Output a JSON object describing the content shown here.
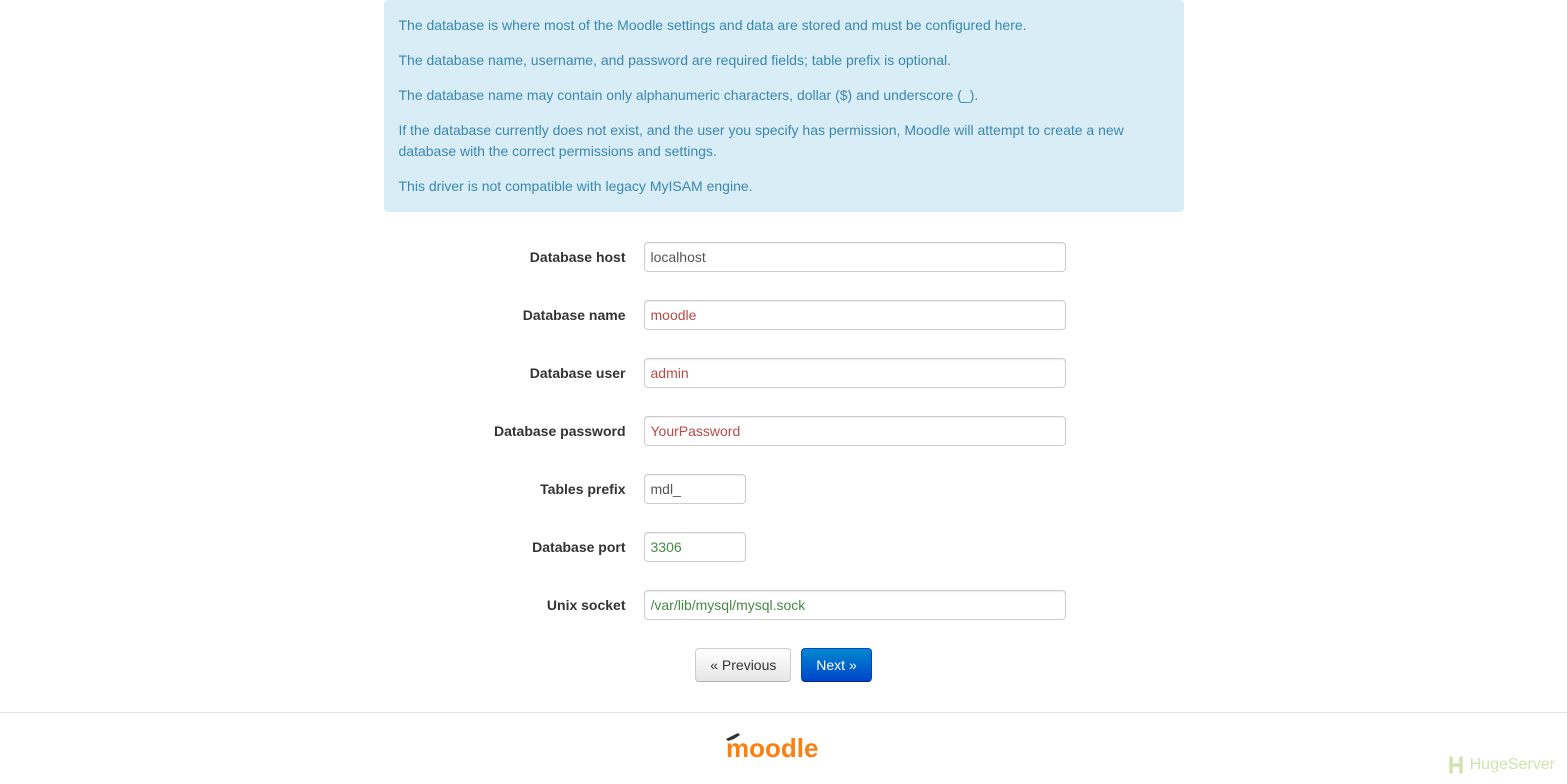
{
  "info": {
    "p1": "The database is where most of the Moodle settings and data are stored and must be configured here.",
    "p2": "The database name, username, and password are required fields; table prefix is optional.",
    "p3": "The database name may contain only alphanumeric characters, dollar ($) and underscore (_).",
    "p4": "If the database currently does not exist, and the user you specify has permission, Moodle will attempt to create a new database with the correct permissions and settings.",
    "p5": "This driver is not compatible with legacy MyISAM engine."
  },
  "form": {
    "dbhost": {
      "label": "Database host",
      "value": "localhost"
    },
    "dbname": {
      "label": "Database name",
      "value": "moodle"
    },
    "dbuser": {
      "label": "Database user",
      "value": "admin"
    },
    "dbpass": {
      "label": "Database password",
      "value": "YourPassword"
    },
    "prefix": {
      "label": "Tables prefix",
      "value": "mdl_"
    },
    "dbport": {
      "label": "Database port",
      "value": "3306"
    },
    "dbsocket": {
      "label": "Unix socket",
      "value": "/var/lib/mysql/mysql.sock"
    }
  },
  "buttons": {
    "previous": "« Previous",
    "next": "Next »"
  },
  "footer": {
    "logo_alt": "Moodle",
    "hugeserver": "HugeServer"
  }
}
